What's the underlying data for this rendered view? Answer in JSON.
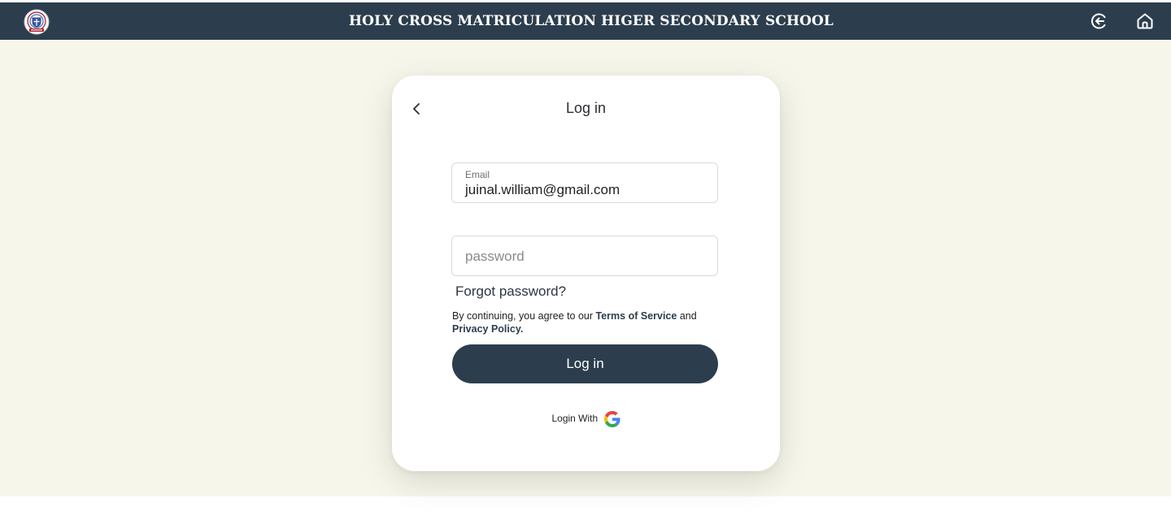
{
  "header": {
    "school_name": "HOLY CROSS MATRICULATION HIGER SECONDARY SCHOOL",
    "logo_icon": "school-crest-icon",
    "exit_icon": "logout-icon",
    "home_icon": "home-icon",
    "background_color": "#2c3e4e"
  },
  "page": {
    "background_color": "#f6f6ea"
  },
  "login_card": {
    "back_icon": "chevron-left-icon",
    "title": "Log in",
    "email": {
      "label": "Email",
      "value": "juinal.william@gmail.com"
    },
    "password": {
      "placeholder": "password"
    },
    "forgot_password": "Forgot password?",
    "terms": {
      "prefix": "By continuing, you agree to our ",
      "terms_link": "Terms of Service",
      "middle": " and",
      "privacy_link": "Privacy Policy."
    },
    "login_button": "Log in",
    "social_login": {
      "label": "Login With",
      "icon": "google-icon"
    }
  }
}
